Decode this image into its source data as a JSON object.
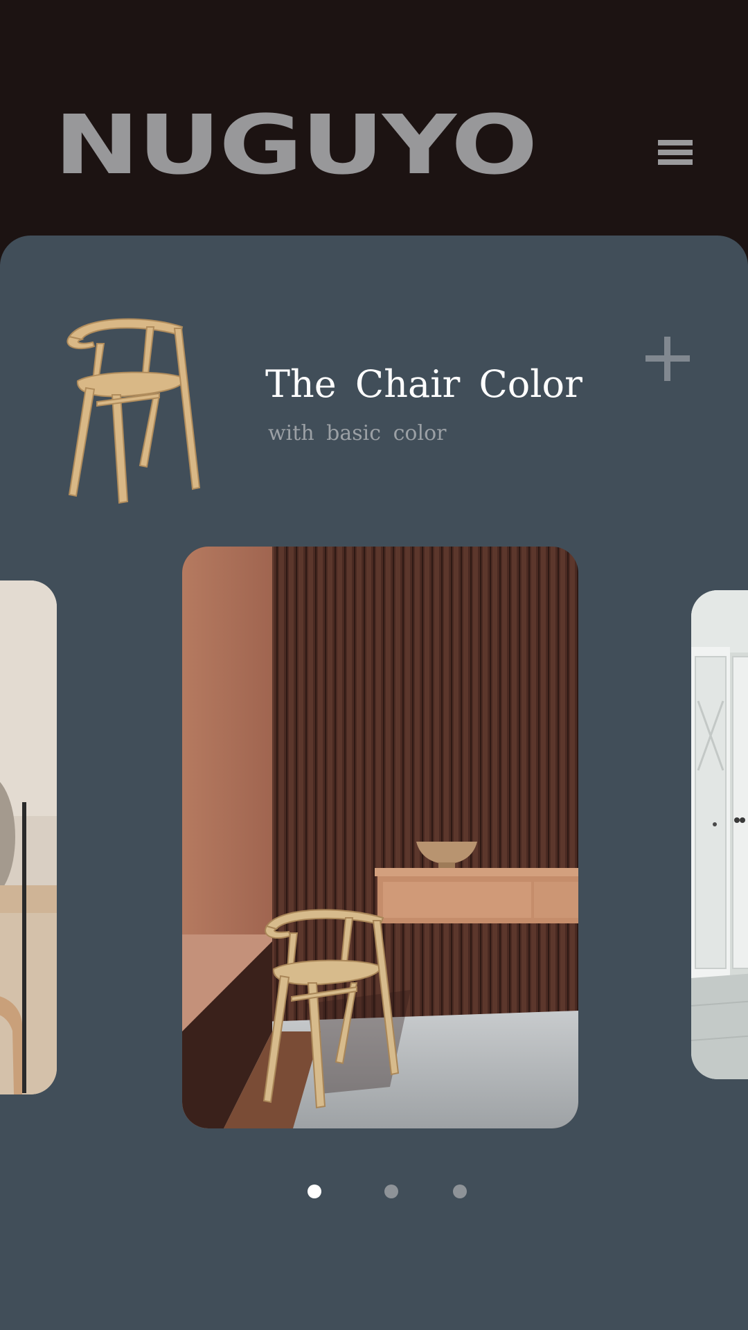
{
  "header": {
    "logo": "NUGUYO",
    "menu_icon": "hamburger-menu-icon"
  },
  "product": {
    "title": "The Chair Color",
    "subtitle": "with basic color",
    "add_icon": "plus-icon"
  },
  "carousel": {
    "slides": [
      {
        "name": "vanity-room-slide"
      },
      {
        "name": "brown-slat-wall-slide"
      },
      {
        "name": "white-door-slide"
      }
    ],
    "active_index": 0,
    "page_count": 3
  },
  "colors": {
    "header_bg": "#1c1312",
    "panel_bg": "#414e59",
    "logo": "#98989a",
    "title": "#ffffff",
    "subtitle": "#9ba0a5",
    "dot_active": "#ffffff",
    "dot_inactive": "#8e9398"
  }
}
